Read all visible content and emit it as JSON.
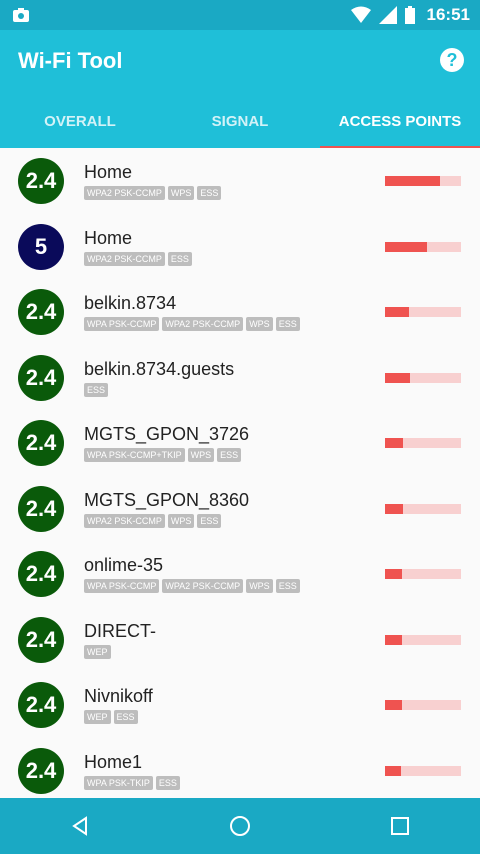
{
  "status": {
    "time": "16:51"
  },
  "app": {
    "title": "Wi-Fi Tool",
    "help": "?"
  },
  "tabs": [
    {
      "label": "OVERALL"
    },
    {
      "label": "SIGNAL"
    },
    {
      "label": "ACCESS POINTS"
    }
  ],
  "networks": [
    {
      "band": "2.4",
      "ssid": "Home",
      "tags": [
        "WPA2 PSK-CCMP",
        "WPS",
        "ESS"
      ],
      "signal": 0.72
    },
    {
      "band": "5",
      "ssid": "Home",
      "tags": [
        "WPA2 PSK-CCMP",
        "ESS"
      ],
      "signal": 0.55
    },
    {
      "band": "2.4",
      "ssid": "belkin.8734",
      "tags": [
        "WPA PSK-CCMP",
        "WPA2 PSK-CCMP",
        "WPS",
        "ESS"
      ],
      "signal": 0.32
    },
    {
      "band": "2.4",
      "ssid": "belkin.8734.guests",
      "tags": [
        "ESS"
      ],
      "signal": 0.33
    },
    {
      "band": "2.4",
      "ssid": "MGTS_GPON_3726",
      "tags": [
        "WPA PSK-CCMP+TKIP",
        "WPS",
        "ESS"
      ],
      "signal": 0.24
    },
    {
      "band": "2.4",
      "ssid": "MGTS_GPON_8360",
      "tags": [
        "WPA2 PSK-CCMP",
        "WPS",
        "ESS"
      ],
      "signal": 0.24
    },
    {
      "band": "2.4",
      "ssid": "onlime-35",
      "tags": [
        "WPA PSK-CCMP",
        "WPA2 PSK-CCMP",
        "WPS",
        "ESS"
      ],
      "signal": 0.23
    },
    {
      "band": "2.4",
      "ssid": "DIRECT-",
      "tags": [
        "WEP"
      ],
      "signal": 0.22
    },
    {
      "band": "2.4",
      "ssid": "Nivnikoff",
      "tags": [
        "WEP",
        "ESS"
      ],
      "signal": 0.22
    },
    {
      "band": "2.4",
      "ssid": "Home1",
      "tags": [
        "WPA PSK-TKIP",
        "ESS"
      ],
      "signal": 0.21
    }
  ]
}
